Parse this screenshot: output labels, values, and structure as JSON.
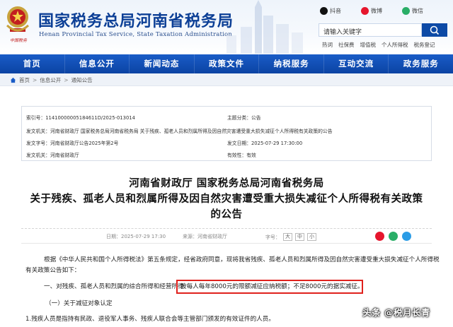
{
  "header": {
    "title": "国家税务总局河南省税务局",
    "subtitle": "Henan Provincial Tax Service, State Taxation Administration",
    "emblem_caption": "中国税务",
    "social": [
      {
        "label": "抖音",
        "color": "#111111"
      },
      {
        "label": "微博",
        "color": "#e6162d"
      },
      {
        "label": "微信",
        "color": "#2aae67"
      }
    ],
    "search_placeholder": "请输入关键字",
    "hot_links": [
      "热词",
      "社保费",
      "增值税",
      "个人所得税",
      "税务登记"
    ]
  },
  "nav": [
    "首页",
    "信息公开",
    "新闻动态",
    "政策文件",
    "纳税服务",
    "互动交流",
    "政务服务"
  ],
  "breadcrumb": [
    "首页",
    "信息公开",
    "通知公告"
  ],
  "meta": {
    "index_label": "索引号：",
    "index_value": "11410000005184611D/2025-013014",
    "subject_label": "主题分类：",
    "subject_value": "公告",
    "issuer_label": "发文机关：",
    "issuer_value": "河南省财政厅 国家税务总局河南省税务局",
    "name_label": "名称：",
    "name_value": "河南省财政厅 国家税务总局河南省税务局 关于残疾、孤老人员和烈属所得及因自然灾害遭受重大损失减征个人所得税有关政策的公告",
    "doc_no_label": "发文字号：",
    "doc_no_value": "河南省财政厅公告2025年第2号",
    "date_label": "发文日期：",
    "date_value": "2025-07-29 17:30:00",
    "org_label": "发文机关：",
    "org_value": "河南省财政厅",
    "validity_label": "有效性：",
    "validity_value": "有效"
  },
  "document": {
    "title_line1": "河南省财政厅 国家税务总局河南省税务局",
    "title_line2": "关于残疾、孤老人员和烈属所得及因自然灾害遭受重大损失减征个人所得税有关政策",
    "title_line3": "的公告",
    "date_label": "日期：",
    "date_value": "2025-07-29 17:30",
    "source_label": "来源：",
    "source_value": "河南省财政厅",
    "size_label": "字号：",
    "sizes": [
      "大",
      "中",
      "小"
    ],
    "para1_line1": "根据《中华人民共和国个人所得税法》第五条规定，经省政府同意，现将我省残疾、孤老人员和烈属所得及因自然灾害遭受重大损失减征个人所得税",
    "para1_line2": "有关政策公告如下：",
    "para2_prefix": "一、对残疾、孤老人员和烈属的综合所得和经营所得",
    "para2_highlight": "按每人每年8000元的限额减征应纳税额；不足8000元的据实减征。",
    "para3": "（一）关于减征对象认定",
    "para4": "1.残疾人员是指持有民政、退役军人事务、残疾人联合会等主管部门颁发的有效证件的人员。"
  },
  "watermark": "头条 @税月长青"
}
